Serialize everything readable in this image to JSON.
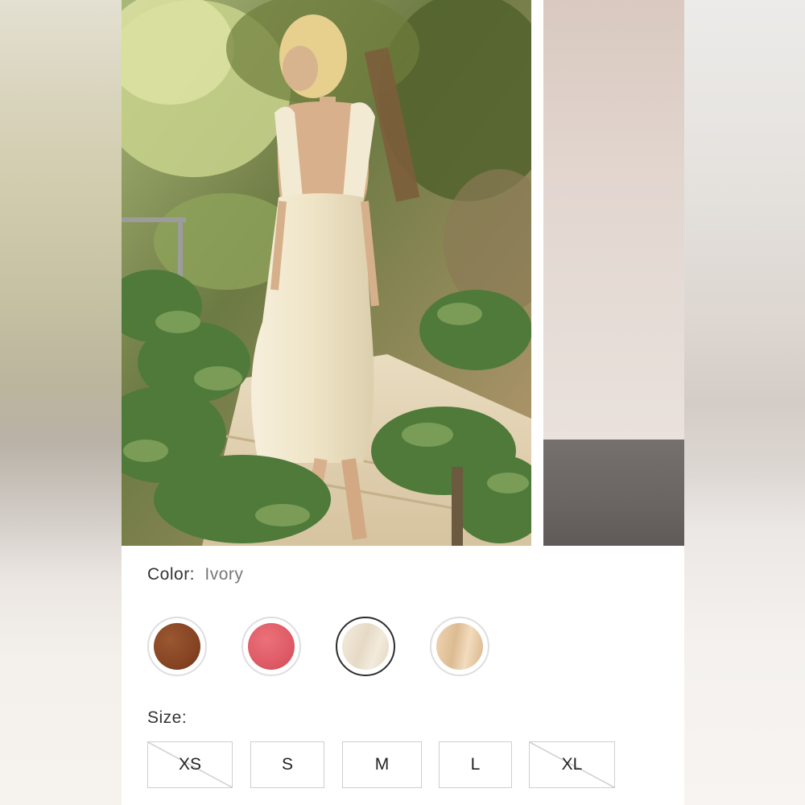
{
  "product": {
    "color_label": "Color:",
    "selected_color": "Ivory",
    "size_label": "Size:"
  },
  "images": {
    "main_alt": "model-in-ivory-dress-garden-photo",
    "secondary_alt": "next-product-photo"
  },
  "colors": [
    {
      "name": "brown",
      "hex": "#8a4a27",
      "selected": false
    },
    {
      "name": "coral",
      "hex": "#e0616b",
      "selected": false
    },
    {
      "name": "ivory",
      "hex": "#ede3d2",
      "selected": true
    },
    {
      "name": "tan",
      "hex": "#e4c8a6",
      "selected": false
    }
  ],
  "sizes": [
    {
      "label": "XS",
      "available": false
    },
    {
      "label": "S",
      "available": true
    },
    {
      "label": "M",
      "available": true
    },
    {
      "label": "L",
      "available": true
    },
    {
      "label": "XL",
      "available": false
    }
  ]
}
